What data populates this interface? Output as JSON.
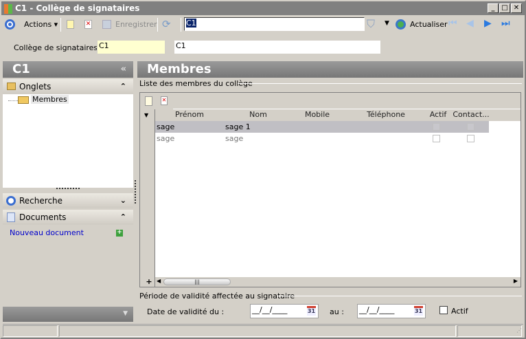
{
  "window": {
    "title": "C1 -  Collège de signataires",
    "min": "_",
    "max": "□",
    "close": "✕"
  },
  "toolbar": {
    "actions": "Actions",
    "save": "Enregistrer",
    "search_value": "C1",
    "refresh": "Actualiser"
  },
  "field": {
    "label": "Collège de signataires :",
    "code": "C1",
    "name": "C1"
  },
  "left": {
    "title": "C1",
    "collapse": "«",
    "onglets": "Onglets",
    "tree_item": "Membres",
    "recherche": "Recherche",
    "documents": "Documents",
    "new_doc": "Nouveau document"
  },
  "main": {
    "title": "Membres",
    "group1": "Liste des membres du collège",
    "columns": [
      "Prénom",
      "Nom",
      "Mobile",
      "Téléphone",
      "Actif",
      "Contact..."
    ],
    "rows": [
      {
        "prenom": "sage",
        "nom": "sage 1",
        "mobile": "",
        "telephone": "",
        "actif": false,
        "contact": false,
        "selected": true
      },
      {
        "prenom": "sage",
        "nom": "sage",
        "mobile": "",
        "telephone": "",
        "actif": false,
        "contact": false,
        "selected": false
      }
    ],
    "add": "+",
    "group2": "Période de validité affectée au signataire",
    "date_from_label": "Date de validité du  :",
    "date_from": "__/__/____",
    "date_to_label": "au :",
    "date_to": "__/__/____",
    "cal": "31",
    "actif_label": "Actif",
    "actif": false
  },
  "colors": {
    "title": "#808080",
    "header": "#888888",
    "link": "#0000cc"
  }
}
